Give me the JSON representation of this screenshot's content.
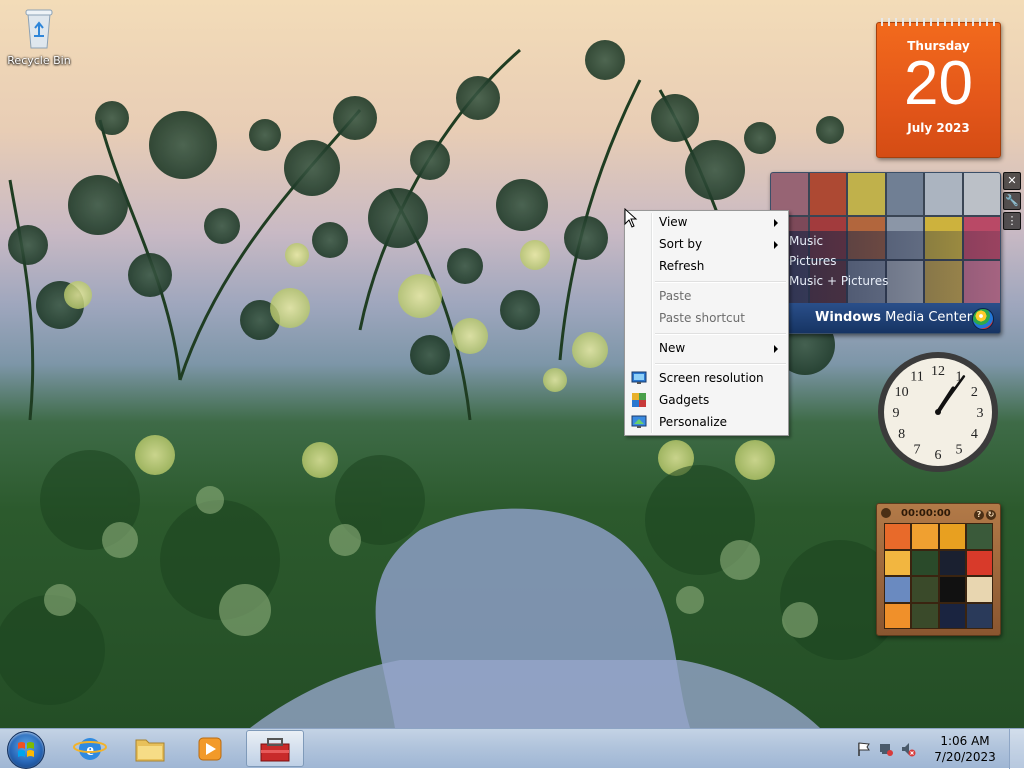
{
  "desktop": {
    "icons": [
      {
        "label": "Recycle Bin",
        "icon": "recycle-bin-icon"
      }
    ]
  },
  "gadgets": {
    "calendar": {
      "day_name": "Thursday",
      "day": "20",
      "month_year": "July 2023"
    },
    "media_center": {
      "items": [
        "Music",
        "Pictures",
        "Music + Pictures"
      ],
      "brand_a": "Windows",
      "brand_b": " Media Center"
    },
    "clock": {
      "numbers": [
        "12",
        "1",
        "2",
        "3",
        "4",
        "5",
        "6",
        "7",
        "8",
        "9",
        "10",
        "11"
      ],
      "hour": 1,
      "minute": 6
    },
    "puzzle": {
      "time": "00:00:00"
    }
  },
  "context_menu": {
    "items": [
      {
        "label": "View",
        "submenu": true,
        "disabled": false
      },
      {
        "label": "Sort by",
        "submenu": true,
        "disabled": false
      },
      {
        "label": "Refresh",
        "submenu": false,
        "disabled": false
      },
      {
        "label": "Paste",
        "submenu": false,
        "disabled": true
      },
      {
        "label": "Paste shortcut",
        "submenu": false,
        "disabled": true
      },
      {
        "label": "New",
        "submenu": true,
        "disabled": false
      },
      {
        "label": "Screen resolution",
        "icon": "screen-resolution-icon"
      },
      {
        "label": "Gadgets",
        "icon": "gadgets-icon"
      },
      {
        "label": "Personalize",
        "icon": "personalize-icon"
      }
    ]
  },
  "taskbar": {
    "pinned": [
      {
        "name": "internet-explorer",
        "icon": "internet-explorer-icon"
      },
      {
        "name": "windows-explorer",
        "icon": "folder-icon"
      },
      {
        "name": "windows-media-player",
        "icon": "media-player-icon"
      },
      {
        "name": "toolbox-app",
        "icon": "toolbox-icon",
        "active": true
      }
    ],
    "time": "1:06 AM",
    "date": "7/20/2023",
    "tray_icons": [
      "action-center-flag-icon",
      "network-icon",
      "volume-muted-icon"
    ]
  },
  "colors": {
    "calendar_orange": "#e3561a",
    "menu_bg": "#f5f5f5",
    "taskbar": "#b1c4dc"
  }
}
